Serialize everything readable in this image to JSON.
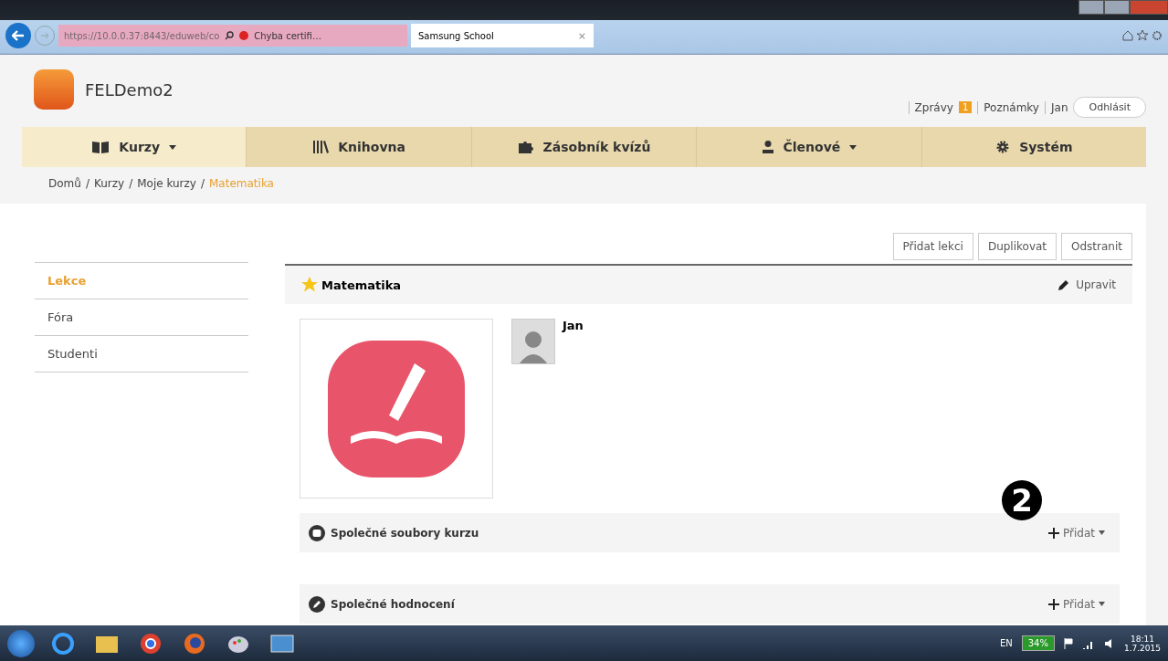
{
  "browser": {
    "address": "https://10.0.0.37:8443/eduweb/co",
    "cert_error": "Chyba certifi…",
    "tab_title": "Samsung School",
    "tab_close": "×"
  },
  "header": {
    "site_name": "FELDemo2",
    "links": [
      {
        "label": "Zprávy",
        "badge": "1"
      },
      {
        "label": "Poznámky"
      }
    ],
    "user": "Jan",
    "logout": "Odhlásit"
  },
  "nav": [
    {
      "label": "Kurzy",
      "dropdown": true,
      "selected": true
    },
    {
      "label": "Knihovna",
      "dropdown": false,
      "selected": false
    },
    {
      "label": "Zásobník kvízů",
      "dropdown": false,
      "selected": false
    },
    {
      "label": "Členové",
      "dropdown": true,
      "selected": false
    },
    {
      "label": "Systém",
      "dropdown": false,
      "selected": false
    }
  ],
  "breadcrumb": [
    {
      "label": "Domů",
      "current": false
    },
    {
      "label": "Kurzy",
      "current": false
    },
    {
      "label": "Moje kurzy",
      "current": false
    },
    {
      "label": "Matematika",
      "current": true
    }
  ],
  "breadcrumb_separator": "/",
  "sidebar": [
    {
      "label": "Lekce",
      "selected": true
    },
    {
      "label": "Fóra",
      "selected": false
    },
    {
      "label": "Studenti",
      "selected": false
    }
  ],
  "actions": [
    "Přidat lekci",
    "Duplikovat",
    "Odstranit"
  ],
  "course": {
    "title": "Matematika",
    "edit": "Upravit",
    "teacher": "Jan"
  },
  "sections": [
    {
      "title": "Společné soubory kurzu",
      "add": "Přidat"
    },
    {
      "title": "Společné hodnocení",
      "add": "Přidat"
    }
  ],
  "callout": "2",
  "taskbar": {
    "language": "EN",
    "battery": "34%",
    "time": "18:11",
    "date": "1.7.2015"
  }
}
